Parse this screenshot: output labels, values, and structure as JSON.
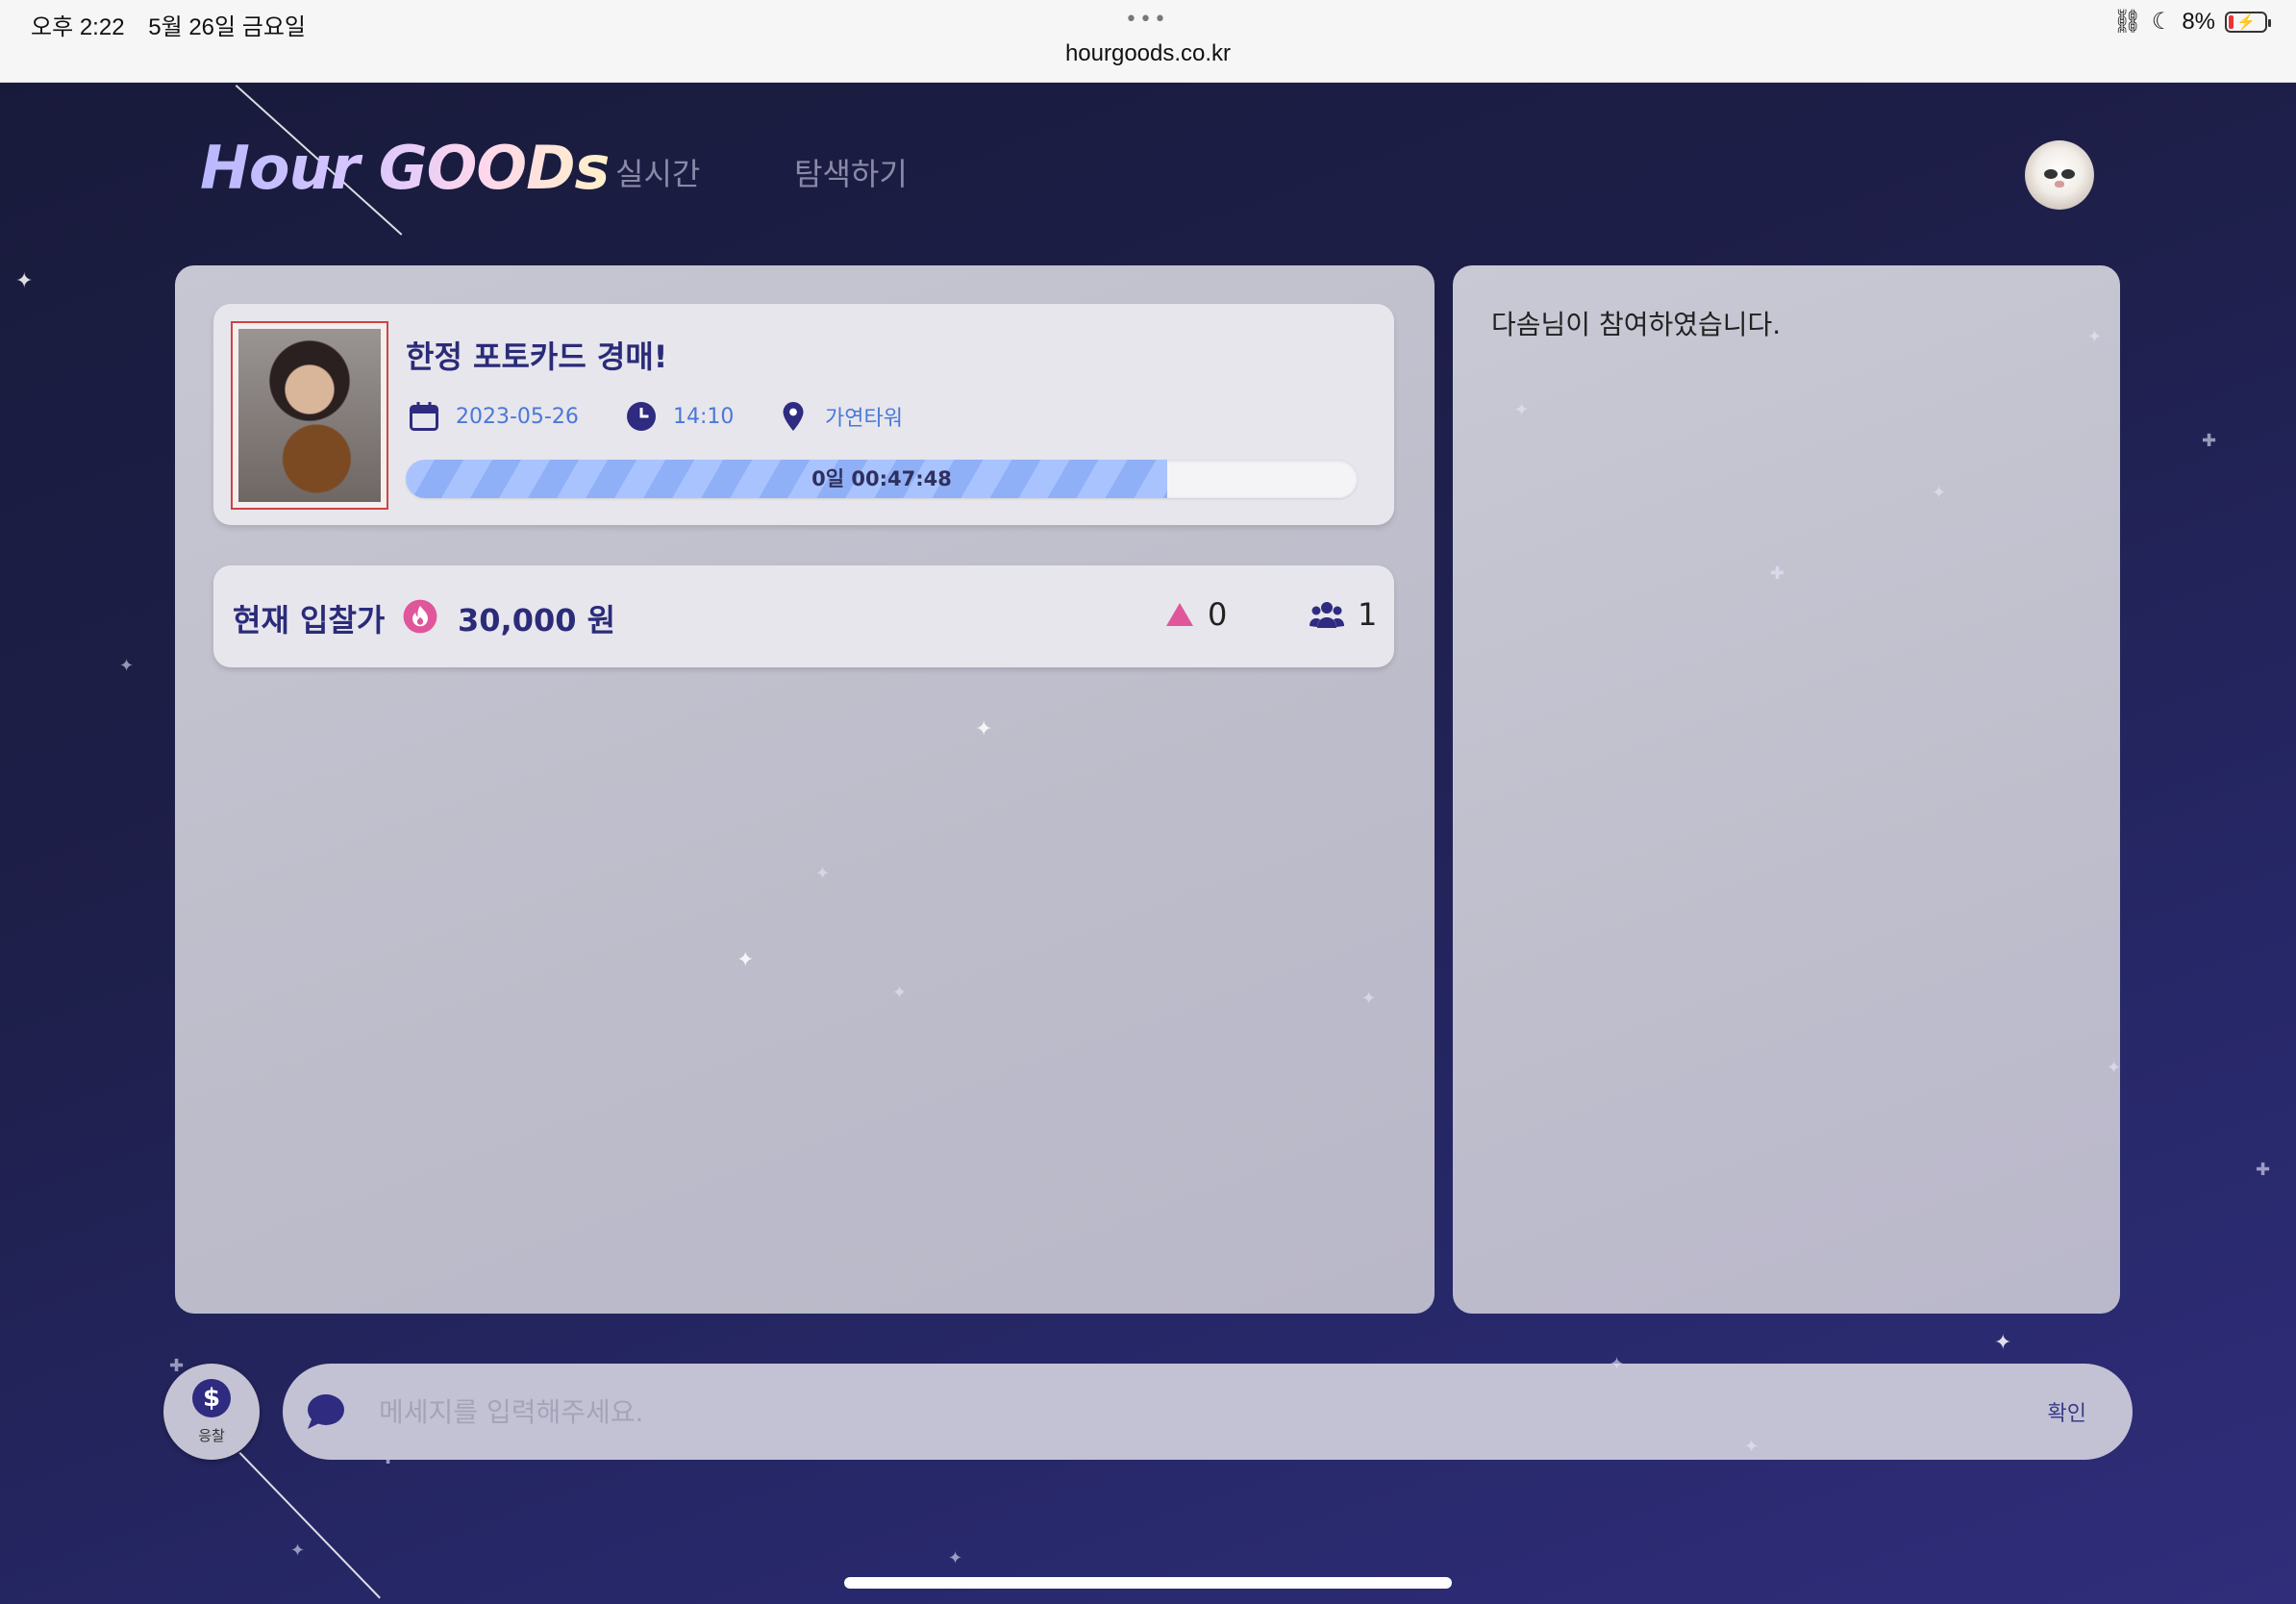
{
  "status_bar": {
    "time": "오후 2:22",
    "date": "5월 26일 금요일",
    "dots": "•••",
    "url": "hourgoods.co.kr",
    "battery": "8%"
  },
  "header": {
    "logo": "Hour GOODs",
    "nav": [
      "실시간",
      "탐색하기"
    ]
  },
  "auction": {
    "title": "한정 포토카드 경매!",
    "date": "2023-05-26",
    "time": "14:10",
    "location": "가연타워",
    "countdown": "0일 00:47:48",
    "progress_fraction": 0.8
  },
  "bid": {
    "label": "현재 입찰가",
    "current_price": "30,000 원",
    "bid_count": "0",
    "participant_count": "1"
  },
  "chat": {
    "messages": [
      "다솜님이 참여하였습니다."
    ],
    "placeholder": "메세지를 입력해주세요.",
    "confirm_label": "확인",
    "bid_button_label": "응찰",
    "bid_button_symbol": "$"
  },
  "colors": {
    "accent": "#2b2b7a",
    "link": "#4a78d8",
    "fire": "#e0569b",
    "progress": "#8fb0f6"
  }
}
